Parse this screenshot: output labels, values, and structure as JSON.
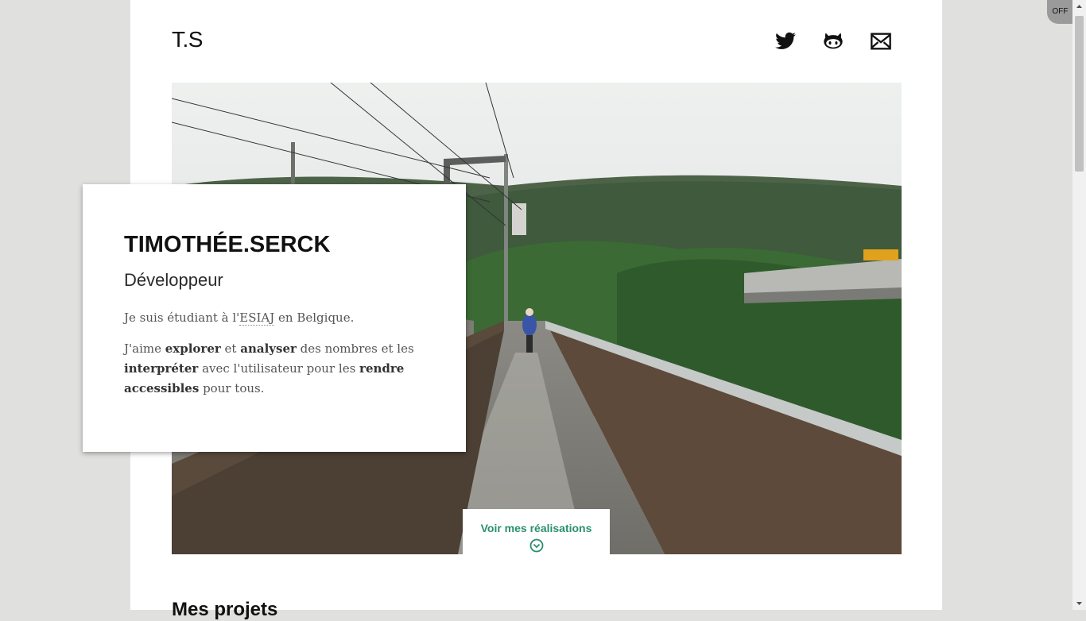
{
  "header": {
    "logo": "T.S",
    "social": [
      {
        "icon": "twitter-icon"
      },
      {
        "icon": "github-icon"
      },
      {
        "icon": "mail-icon"
      }
    ]
  },
  "intro": {
    "name": "TIMOTHÉE.SERCK",
    "role": "Développeur",
    "p1": {
      "a": "Je suis étudiant à l'",
      "abbr": "ESIAJ",
      "b": " en Belgique."
    },
    "p2": {
      "t1": "J'aime ",
      "b1": "explorer",
      "t2": " et ",
      "b2": "analyser",
      "t3": " des nombres et les ",
      "b3": "interpréter",
      "t4": " avec l'utilisateur pour les ",
      "b4": "rendre accessibles",
      "t5": " pour tous."
    }
  },
  "cta": {
    "label": "Voir mes réalisations",
    "icon": "chevron-down-circle-icon"
  },
  "projects": {
    "title": "Mes projets"
  },
  "toggle": {
    "label": "OFF"
  },
  "colors": {
    "accent": "#2a8f6f",
    "background": "#e0e0de"
  }
}
